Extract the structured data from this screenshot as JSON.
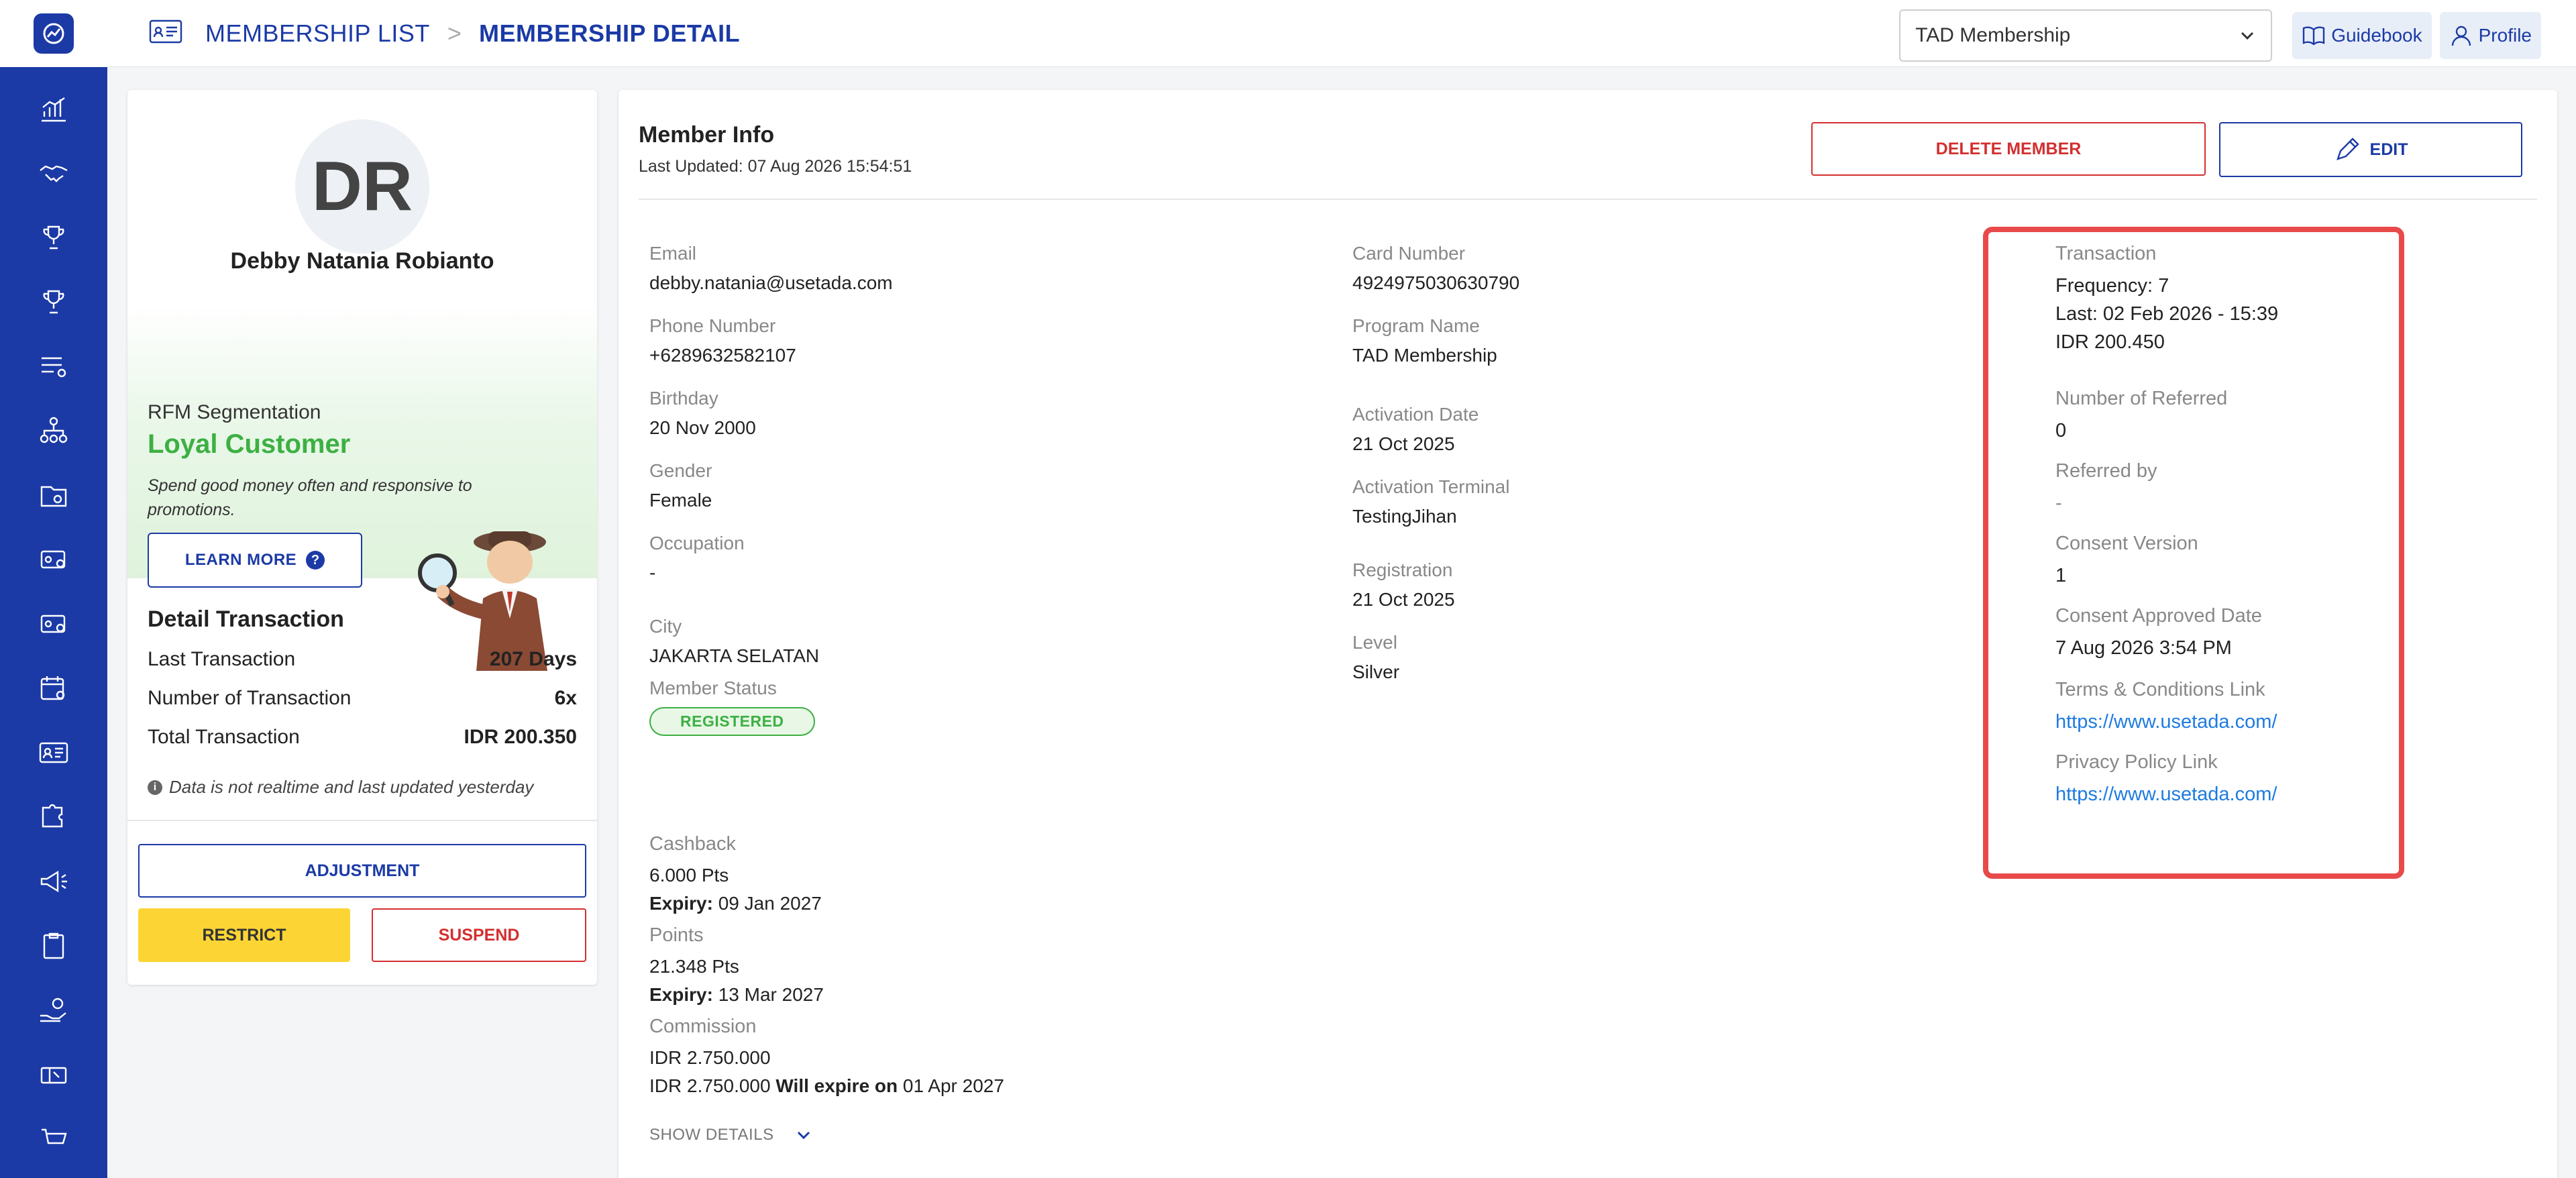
{
  "breadcrumb": {
    "list": "MEMBERSHIP LIST",
    "separator": ">",
    "detail": "MEMBERSHIP DETAIL"
  },
  "header": {
    "program_select": "TAD Membership",
    "guidebook_label": "Guidebook",
    "profile_label": "Profile"
  },
  "sidebar": {
    "items": [
      "chart-icon",
      "handshake-icon",
      "trophy-icon",
      "trophy-icon",
      "list-settings-icon",
      "org-chart-icon",
      "folder-gear-icon",
      "card-gear-icon",
      "card-gear-icon",
      "calendar-gear-icon",
      "member-card-icon",
      "puzzle-gear-icon",
      "megaphone-icon",
      "clipboard-icon",
      "hand-coin-icon",
      "coupon-icon",
      "cart-icon"
    ]
  },
  "profile": {
    "initials": "DR",
    "name": "Debby Natania Robianto",
    "rfm_label": "RFM Segmentation",
    "rfm_value": "Loyal Customer",
    "rfm_desc": "Spend good money often and responsive to promotions.",
    "learn_more": "LEARN MORE",
    "accent": "#3cb043"
  },
  "detail_transaction": {
    "title": "Detail Transaction",
    "rows": [
      {
        "label": "Last Transaction",
        "value": "207 Days"
      },
      {
        "label": "Number of Transaction",
        "value": "6x"
      },
      {
        "label": "Total Transaction",
        "value": "IDR 200.350"
      }
    ],
    "note": "Data is not realtime and last updated yesterday"
  },
  "actions": {
    "adjustment": "ADJUSTMENT",
    "restrict": "RESTRICT",
    "suspend": "SUSPEND"
  },
  "member_info": {
    "title": "Member Info",
    "last_updated": "Last Updated: 07 Aug 2026 15:54:51",
    "delete": "DELETE MEMBER",
    "edit": "EDIT",
    "col1": [
      {
        "label": "Email",
        "value": "debby.natania@usetada.com"
      },
      {
        "label": "Phone Number",
        "value": "+6289632582107"
      },
      {
        "label": "Birthday",
        "value": "20 Nov 2000"
      },
      {
        "label": "Gender",
        "value": "Female"
      },
      {
        "label": "Occupation",
        "value": "-"
      },
      {
        "label": "City",
        "value": "JAKARTA SELATAN"
      }
    ],
    "member_status_label": "Member Status",
    "member_status": "REGISTERED",
    "col2": [
      {
        "label": "Card Number",
        "value": "4924975030630790"
      },
      {
        "label": "Program Name",
        "value": "TAD Membership"
      },
      {
        "label": "Activation Date",
        "value": "21 Oct 2025"
      },
      {
        "label": "Activation Terminal",
        "value": "TestingJihan"
      },
      {
        "label": "Registration",
        "value": "21 Oct 2025"
      },
      {
        "label": "Level",
        "value": "Silver"
      }
    ],
    "col3": {
      "transaction_label": "Transaction",
      "transaction_frequency": "Frequency: 7",
      "transaction_last": "Last: 02 Feb 2026 - 15:39",
      "transaction_amount": "IDR 200.450",
      "referred_label": "Number of Referred",
      "referred_value": "0",
      "referred_by_label": "Referred by",
      "referred_by_value": "-",
      "consent_version_label": "Consent Version",
      "consent_version_value": "1",
      "consent_date_label": "Consent Approved Date",
      "consent_date_value": "7 Aug 2026 3:54 PM",
      "terms_label": "Terms & Conditions Link",
      "terms_link": "https://www.usetada.com/",
      "privacy_label": "Privacy Policy Link",
      "privacy_link": "https://www.usetada.com/"
    },
    "cashback": {
      "label": "Cashback",
      "value": "6.000 Pts",
      "expiry_label": "Expiry:",
      "expiry": "09 Jan 2027"
    },
    "points": {
      "label": "Points",
      "value": "21.348 Pts",
      "expiry_label": "Expiry:",
      "expiry": "13 Mar 2027"
    },
    "commission": {
      "label": "Commission",
      "value": "IDR 2.750.000",
      "value2": "IDR 2.750.000",
      "expire_label": "Will expire on",
      "expire_date": "01 Apr 2027"
    },
    "show_details": "SHOW DETAILS"
  },
  "colors": {
    "brand": "#1b3aa6",
    "danger": "#d32f2f",
    "warning": "#fcd535",
    "link": "#1e7be0",
    "highlight": "#e84a4a"
  }
}
